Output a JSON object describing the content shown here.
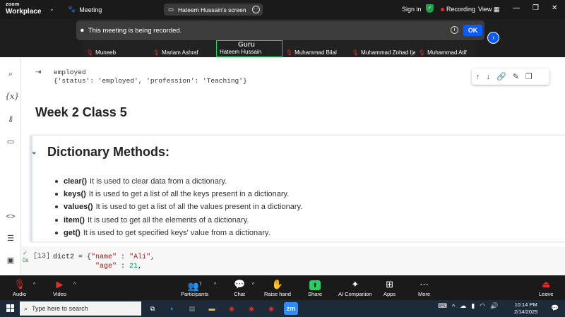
{
  "zoom_top": {
    "logo_line1": "zoom",
    "logo_line2": "Workplace",
    "meeting_label": "Meeting",
    "screen_share_label": "Hateem Hussain's screen",
    "signin": "Sign in",
    "recording": "Recording",
    "view": "View"
  },
  "recording_banner": {
    "text": "This meeting is being recorded.",
    "ok": "OK"
  },
  "participants_strip": [
    {
      "name": "Muneeb",
      "muted": true,
      "active": false
    },
    {
      "name": "Mariam Ashraf",
      "muted": true,
      "active": false
    },
    {
      "name": "Hateem Hussain",
      "muted": false,
      "active": true
    },
    {
      "name": "Muhammad Bilal",
      "muted": true,
      "active": false
    },
    {
      "name": "Muhammad Zohad Ijaz",
      "muted": true,
      "active": false
    },
    {
      "name": "Muhammad Atif",
      "muted": true,
      "active": false
    }
  ],
  "tile_watermark": "Guru",
  "notebook": {
    "output_line1": "employed",
    "output_line2": "{'status': 'employed', 'profession': 'Teaching'}",
    "heading_week": "Week 2 Class 5",
    "heading_dict": "Dictionary Methods:",
    "methods": [
      {
        "name": "clear()",
        "desc": "It is used to clear data from a dictionary."
      },
      {
        "name": "keys()",
        "desc": "It is used to get a list of all the keys present in a dictionary."
      },
      {
        "name": "values()",
        "desc": "It is used to get a list of all the values present in a dictionary."
      },
      {
        "name": "item()",
        "desc": "It is used to get all the elements of a dictionary."
      },
      {
        "name": "get()",
        "desc": "It is used to get specified keys' value from a dictionary."
      }
    ],
    "exec_count": "[13]",
    "run_time": "0s",
    "code_line1_var": "dict2 = ",
    "code_line1_key": "\"name\"",
    "code_line1_sep": " : ",
    "code_line1_val": "\"Ali\"",
    "code_line2_key": "\"age\"",
    "code_line2_sep": " : ",
    "code_line2_val": "21"
  },
  "zoom_bottom": {
    "audio": "Audio",
    "video": "Video",
    "participants": "Participants",
    "participants_count": "7",
    "chat": "Chat",
    "raise_hand": "Raise hand",
    "share": "Share",
    "ai_companion": "AI Companion",
    "apps": "Apps",
    "more": "More",
    "leave": "Leave"
  },
  "taskbar": {
    "search_placeholder": "Type here to search",
    "time": "10:14 PM",
    "date": "2/14/2025",
    "zoom_app_label": "zm"
  },
  "colors": {
    "zoom_blue": "#0b5cff",
    "active_green": "#23d160",
    "record_red": "#e0302a"
  }
}
